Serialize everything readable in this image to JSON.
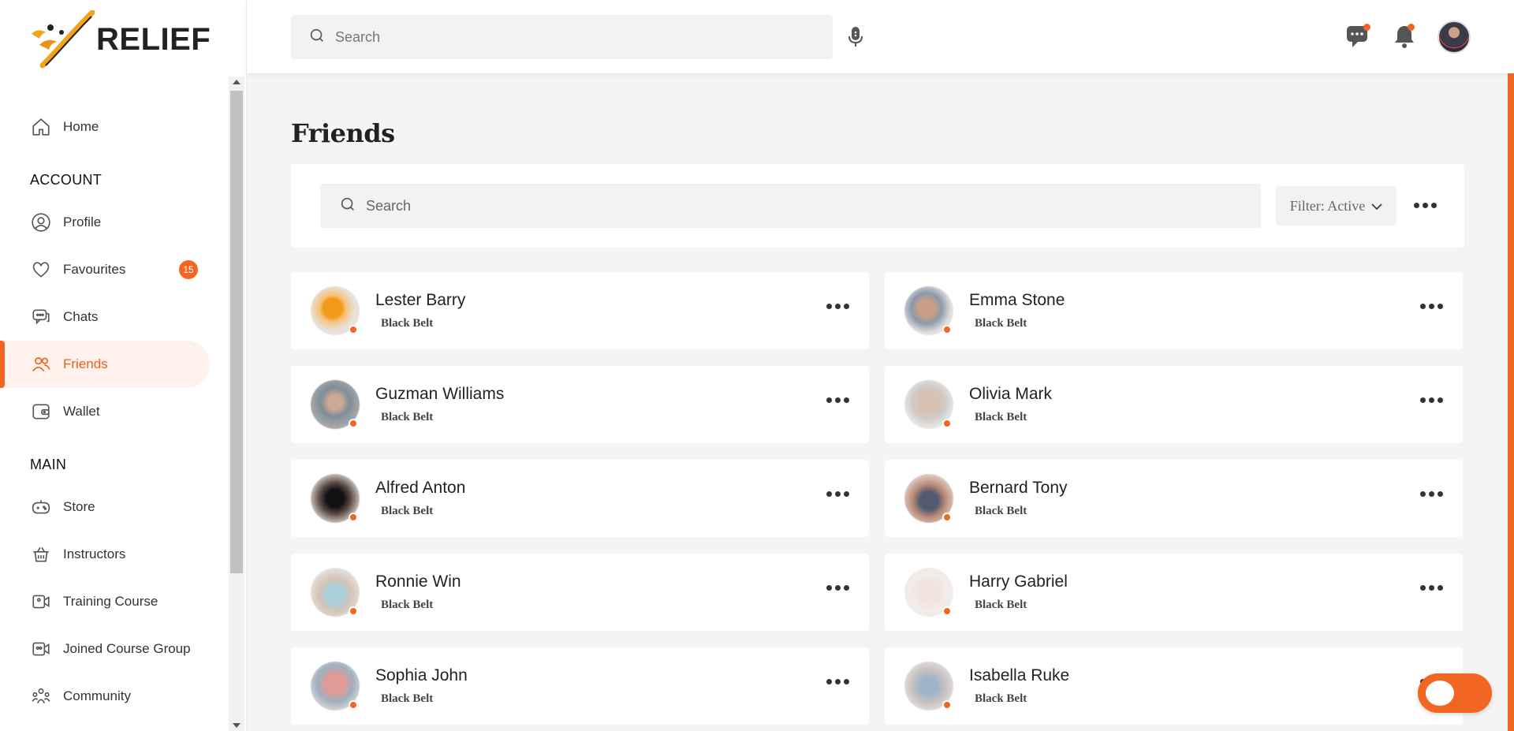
{
  "app": {
    "logo_text": "RELIEF"
  },
  "sidebar": {
    "home": "Home",
    "account_title": "ACCOUNT",
    "items_account": [
      {
        "label": "Profile",
        "icon": "profile-icon"
      },
      {
        "label": "Favourites",
        "icon": "heart-icon",
        "badge": "15"
      },
      {
        "label": "Chats",
        "icon": "chat-icon"
      },
      {
        "label": "Friends",
        "icon": "users-icon",
        "active": true
      },
      {
        "label": "Wallet",
        "icon": "wallet-icon"
      }
    ],
    "main_title": "MAIN",
    "items_main": [
      {
        "label": "Store",
        "icon": "gamepad-icon"
      },
      {
        "label": "Instructors",
        "icon": "basket-icon"
      },
      {
        "label": "Training Course",
        "icon": "video-icon"
      },
      {
        "label": "Joined Course Group",
        "icon": "video-group-icon"
      },
      {
        "label": "Community",
        "icon": "community-icon"
      }
    ]
  },
  "header": {
    "search_placeholder": "Search"
  },
  "page": {
    "title": "Friends",
    "search_placeholder": "Search",
    "filter_label": "Filter: Active"
  },
  "friends": [
    {
      "name": "Lester Barry",
      "rank": "Black Belt"
    },
    {
      "name": "Emma Stone",
      "rank": "Black Belt"
    },
    {
      "name": "Guzman Williams",
      "rank": "Black Belt"
    },
    {
      "name": "Olivia Mark",
      "rank": "Black Belt"
    },
    {
      "name": "Alfred Anton",
      "rank": "Black Belt"
    },
    {
      "name": "Bernard Tony",
      "rank": "Black Belt"
    },
    {
      "name": "Ronnie Win",
      "rank": "Black Belt"
    },
    {
      "name": "Harry Gabriel",
      "rank": "Black Belt"
    },
    {
      "name": "Sophia John",
      "rank": "Black Belt"
    },
    {
      "name": "Isabella Ruke",
      "rank": "Black Belt"
    }
  ],
  "colors": {
    "accent": "#f26522",
    "active_bg": "#fff1eb",
    "page_bg": "#f4f4f4"
  }
}
